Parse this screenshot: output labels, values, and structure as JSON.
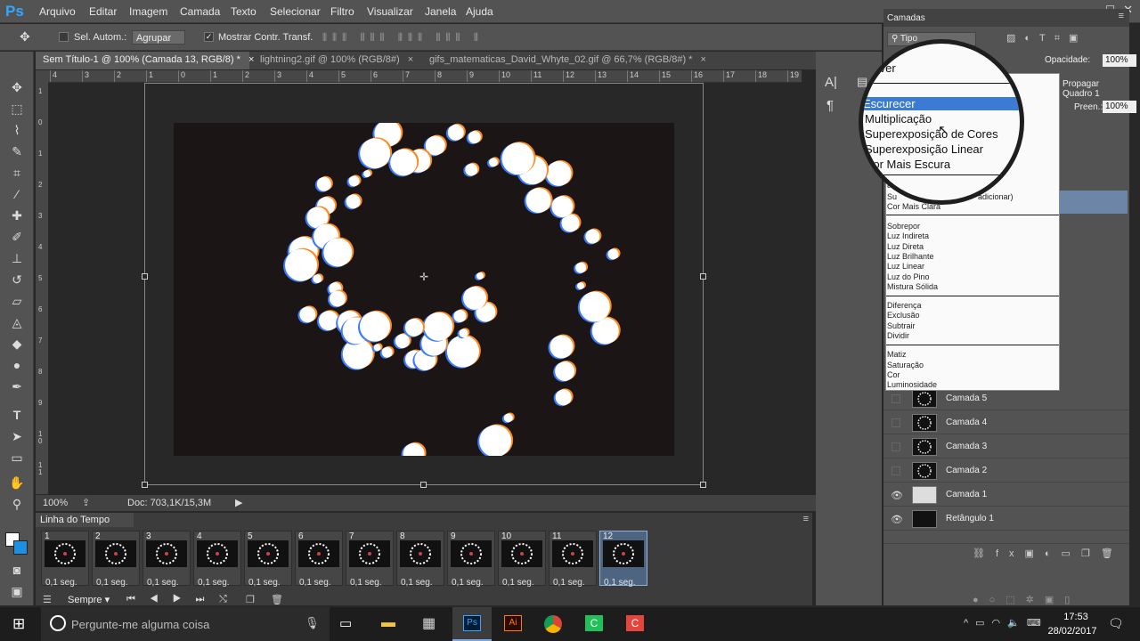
{
  "menubar": {
    "logo": "Ps",
    "items": [
      "Arquivo",
      "Editar",
      "Imagem",
      "Camada",
      "Texto",
      "Selecionar",
      "Filtro",
      "Visualizar",
      "Janela",
      "Ajuda"
    ]
  },
  "options": {
    "auto_select_label": "Sel. Autom.:",
    "auto_select_value": "Agrupar",
    "show_transform_label": "Mostrar Contr. Transf."
  },
  "doc_tabs": [
    {
      "label": "Sem Título-1 @ 100% (Camada 13, RGB/8) *"
    },
    {
      "label": "lightning2.gif @ 100% (RGB/8#)"
    },
    {
      "label": "gifs_matematicas_David_Whyte_02.gif @ 66,7% (RGB/8#) *"
    }
  ],
  "ruler_top": [
    "4",
    "3",
    "2",
    "1",
    "0",
    "1",
    "2",
    "3",
    "4",
    "5",
    "6",
    "7",
    "8",
    "9",
    "10",
    "11",
    "12",
    "13",
    "14",
    "15",
    "16",
    "17",
    "18",
    "19"
  ],
  "ruler_left": [
    "1",
    "0",
    "1",
    "2",
    "3",
    "4",
    "5",
    "6",
    "7",
    "8",
    "9",
    "1\n0",
    "1\n1"
  ],
  "status": {
    "zoom": "100%",
    "doc": "Doc: 703,1K/15,3M"
  },
  "timeline": {
    "title": "Linha do Tempo",
    "loop": "Sempre",
    "frames": [
      {
        "num": "1",
        "delay": "0,1 seg."
      },
      {
        "num": "2",
        "delay": "0,1 seg."
      },
      {
        "num": "3",
        "delay": "0,1 seg."
      },
      {
        "num": "4",
        "delay": "0,1 seg."
      },
      {
        "num": "5",
        "delay": "0,1 seg."
      },
      {
        "num": "6",
        "delay": "0,1 seg."
      },
      {
        "num": "7",
        "delay": "0,1 seg."
      },
      {
        "num": "8",
        "delay": "0,1 seg."
      },
      {
        "num": "9",
        "delay": "0,1 seg."
      },
      {
        "num": "10",
        "delay": "0,1 seg."
      },
      {
        "num": "11",
        "delay": "0,1 seg."
      },
      {
        "num": "12",
        "delay": "0,1 seg."
      }
    ]
  },
  "layers_panel": {
    "tab": "Camadas",
    "filter": "Tipo",
    "opacity_label": "Opacidade:",
    "opacity_value": "100%",
    "fill_label": "Preen.:",
    "fill_value": "100%",
    "propagate": "Propagar Quadro 1",
    "layers": [
      "Camada 5",
      "Camada 4",
      "Camada 3",
      "Camada 2",
      "Camada 1",
      "Retângulo 1"
    ]
  },
  "blend_dropdown": {
    "groups": [
      [
        "Sobrepor",
        "Luz Indireta",
        "Luz Direta",
        "Luz Brilhante",
        "Luz Linear",
        "Luz do Pino",
        "Mistura Sólida"
      ],
      [
        "Diferença",
        "Exclusão",
        "Subtrair",
        "Dividir"
      ],
      [
        "Matiz",
        "Saturação",
        "Cor",
        "Luminosidade"
      ]
    ],
    "partial_top": [
      "ar",
      "Su",
      "adicionar)",
      "Cor Mais Clara"
    ]
  },
  "magnifier": {
    "items": [
      "solver",
      "Escurecer",
      "Multiplicação",
      "Superexposição de Cores",
      "Superexposição Linear",
      "Cor Mais Escura",
      "ar"
    ]
  },
  "taskbar": {
    "search": "Pergunte-me alguma coisa",
    "time": "17:53",
    "date": "28/02/2017"
  },
  "colors": {
    "accent": "#3b7bd4",
    "bg": "#535353",
    "canvas": "#1c1516"
  }
}
